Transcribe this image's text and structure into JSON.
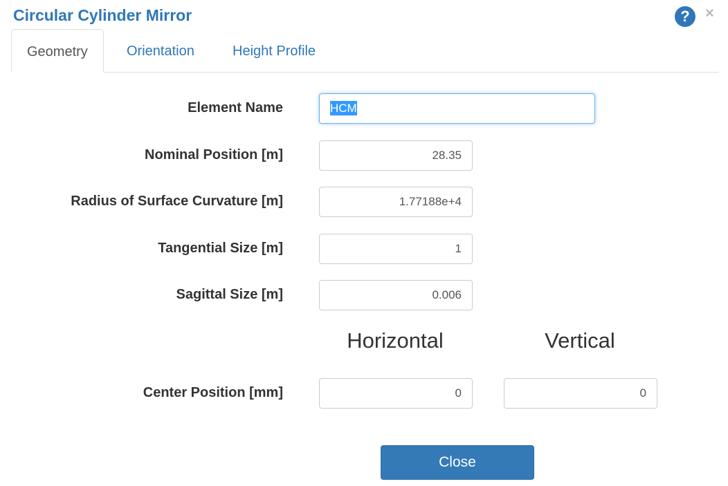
{
  "dialog": {
    "title": "Circular Cylinder Mirror",
    "close_glyph": "×",
    "help_glyph": "?"
  },
  "tabs": [
    {
      "label": "Geometry",
      "active": true
    },
    {
      "label": "Orientation",
      "active": false
    },
    {
      "label": "Height Profile",
      "active": false
    }
  ],
  "form": {
    "element_name": {
      "label": "Element Name",
      "value": "HCM"
    },
    "nominal_position": {
      "label": "Nominal Position [m]",
      "value": "28.35"
    },
    "radius_curvature": {
      "label": "Radius of Surface Curvature [m]",
      "value": "1.77188e+4"
    },
    "tangential_size": {
      "label": "Tangential Size [m]",
      "value": "1"
    },
    "sagittal_size": {
      "label": "Sagittal Size [m]",
      "value": "0.006"
    },
    "column_headers": {
      "horizontal": "Horizontal",
      "vertical": "Vertical"
    },
    "center_position": {
      "label": "Center Position [mm]",
      "horizontal": "0",
      "vertical": "0"
    }
  },
  "footer": {
    "close_label": "Close"
  },
  "colors": {
    "accent": "#337ab7",
    "title": "#2f77b8"
  }
}
